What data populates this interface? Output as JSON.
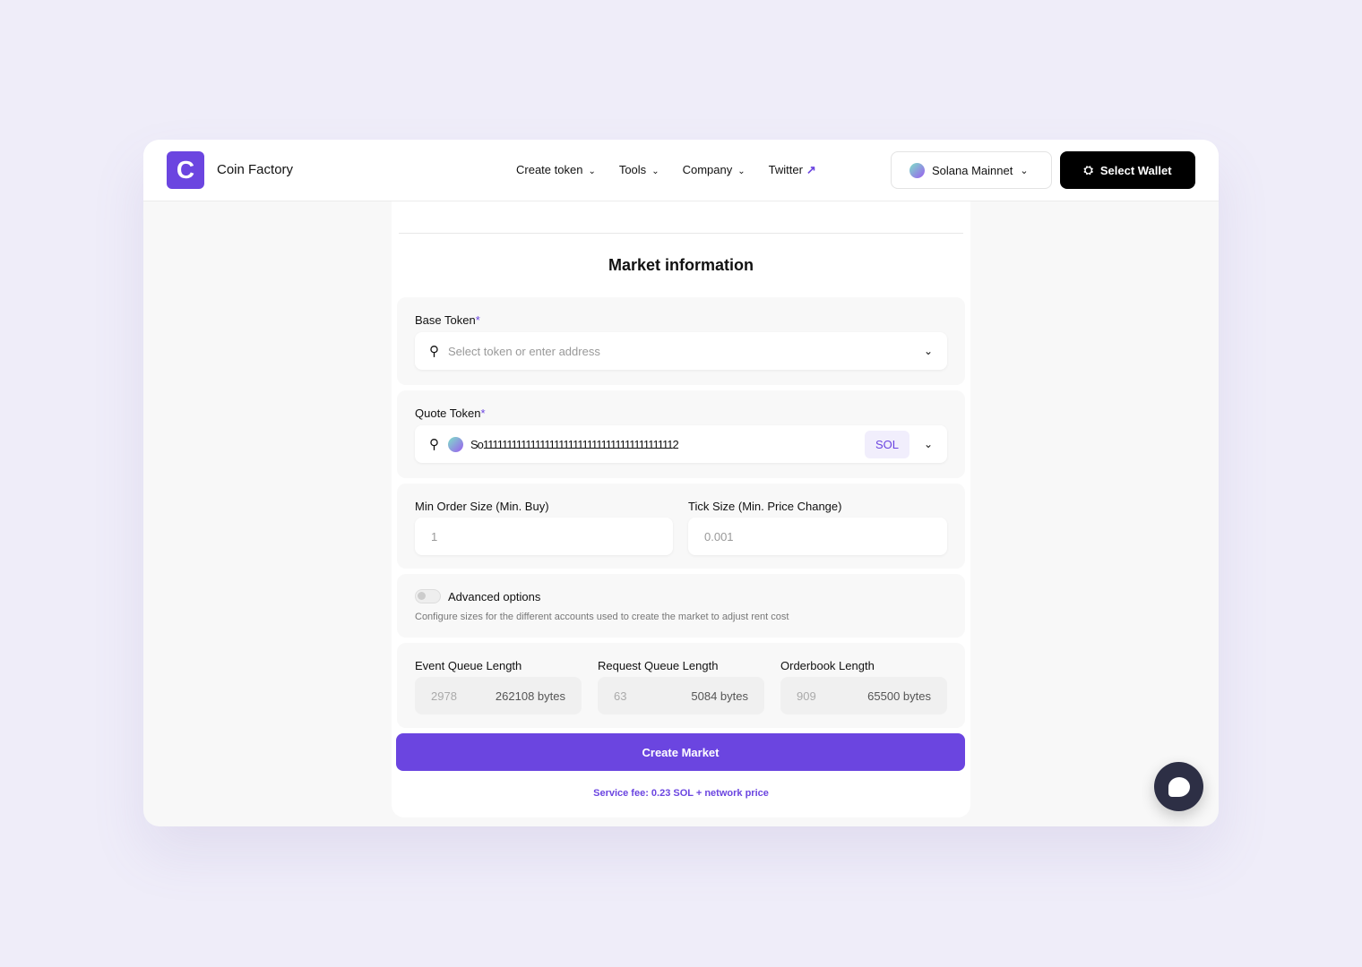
{
  "header": {
    "brand": "Coin Factory",
    "logo_letter": "C",
    "nav": [
      {
        "label": "Create token"
      },
      {
        "label": "Tools"
      },
      {
        "label": "Company"
      },
      {
        "label": "Twitter"
      }
    ],
    "network": "Solana Mainnet",
    "wallet_button": "Select Wallet"
  },
  "form": {
    "title": "Market information",
    "base_token": {
      "label": "Base Token",
      "required": "*",
      "placeholder": "Select token or enter address"
    },
    "quote_token": {
      "label": "Quote Token",
      "required": "*",
      "value": "So11111111111111111111111111111111111111112",
      "symbol": "SOL"
    },
    "min_order": {
      "label": "Min Order Size (Min. Buy)",
      "placeholder": "1"
    },
    "tick_size": {
      "label": "Tick Size (Min. Price Change)",
      "placeholder": "0.001"
    },
    "advanced": {
      "label": "Advanced options",
      "enabled": false,
      "description": "Configure sizes for the different accounts used to create the market to adjust rent cost"
    },
    "queues": [
      {
        "label": "Event Queue Length",
        "value": "2978",
        "bytes": "262108 bytes"
      },
      {
        "label": "Request Queue Length",
        "value": "63",
        "bytes": "5084 bytes"
      },
      {
        "label": "Orderbook Length",
        "value": "909",
        "bytes": "65500 bytes"
      }
    ],
    "submit": "Create Market",
    "fee": "Service fee: 0.23 SOL + network price"
  },
  "colors": {
    "accent": "#6b45e0",
    "background": "#efedf9"
  }
}
